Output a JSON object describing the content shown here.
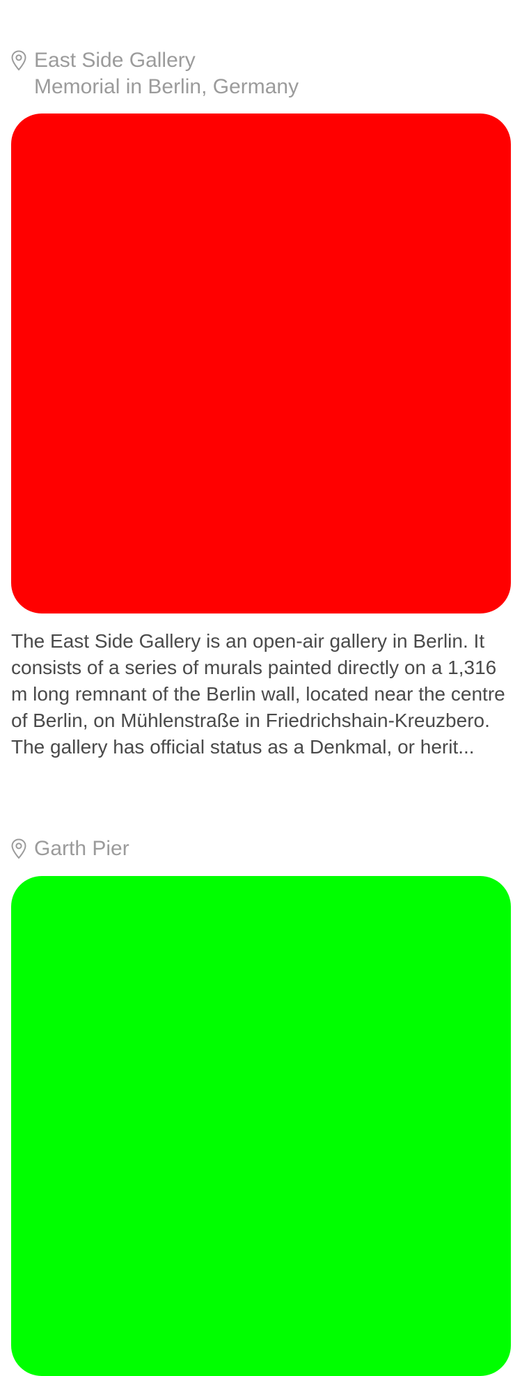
{
  "cards": [
    {
      "title": "East Side Gallery",
      "subtitle": "Memorial in Berlin, Germany",
      "icon": "location-pin-icon",
      "image_color": "#ff0000",
      "description": "The East Side Gallery is an open-air gallery in Berlin. It consists of a series of murals painted directly on a 1,316 m long remnant of the Berlin wall, located near the centre of Berlin, on Mühlenstraße in Friedrichshain-Kreuzbero. The gallery has official status as a Denkmal, or herit..."
    },
    {
      "title": "Garth Pier",
      "icon": "location-pin-icon",
      "image_color": "#00ff00"
    }
  ],
  "colors": {
    "secondary_text": "#9b9b9b",
    "body_text": "#4a4a4a",
    "background": "#ffffff"
  }
}
